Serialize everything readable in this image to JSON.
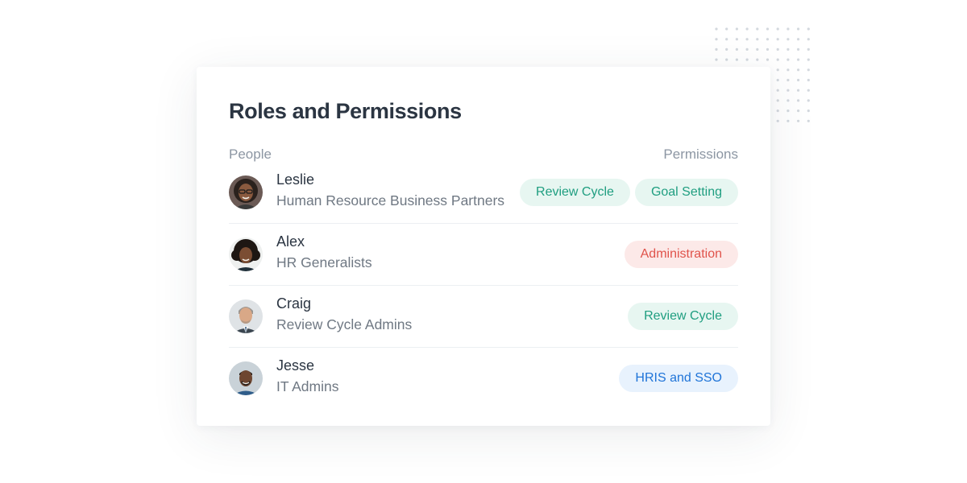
{
  "card": {
    "title": "Roles and Permissions",
    "col_people": "People",
    "col_permissions": "Permissions"
  },
  "people": [
    {
      "name": "Leslie",
      "role": "Human Resource Business Partners",
      "avatar": "woman-glasses-avatar",
      "permissions": [
        {
          "label": "Review Cycle",
          "color": "#1f9e80",
          "bg": "#e7f6f1"
        },
        {
          "label": "Goal Setting",
          "color": "#1f9e80",
          "bg": "#e7f6f1"
        }
      ]
    },
    {
      "name": "Alex",
      "role": "HR Generalists",
      "avatar": "woman-curly-hair-avatar",
      "permissions": [
        {
          "label": "Administration",
          "color": "#e0534b",
          "bg": "#fce9e8"
        }
      ]
    },
    {
      "name": "Craig",
      "role": "Review Cycle Admins",
      "avatar": "man-suit-avatar",
      "permissions": [
        {
          "label": "Review Cycle",
          "color": "#1f9e80",
          "bg": "#e7f6f1"
        }
      ]
    },
    {
      "name": "Jesse",
      "role": "IT Admins",
      "avatar": "man-smiling-avatar",
      "permissions": [
        {
          "label": "HRIS and SSO",
          "color": "#1f74d8",
          "bg": "#e8f2fd"
        }
      ]
    }
  ]
}
